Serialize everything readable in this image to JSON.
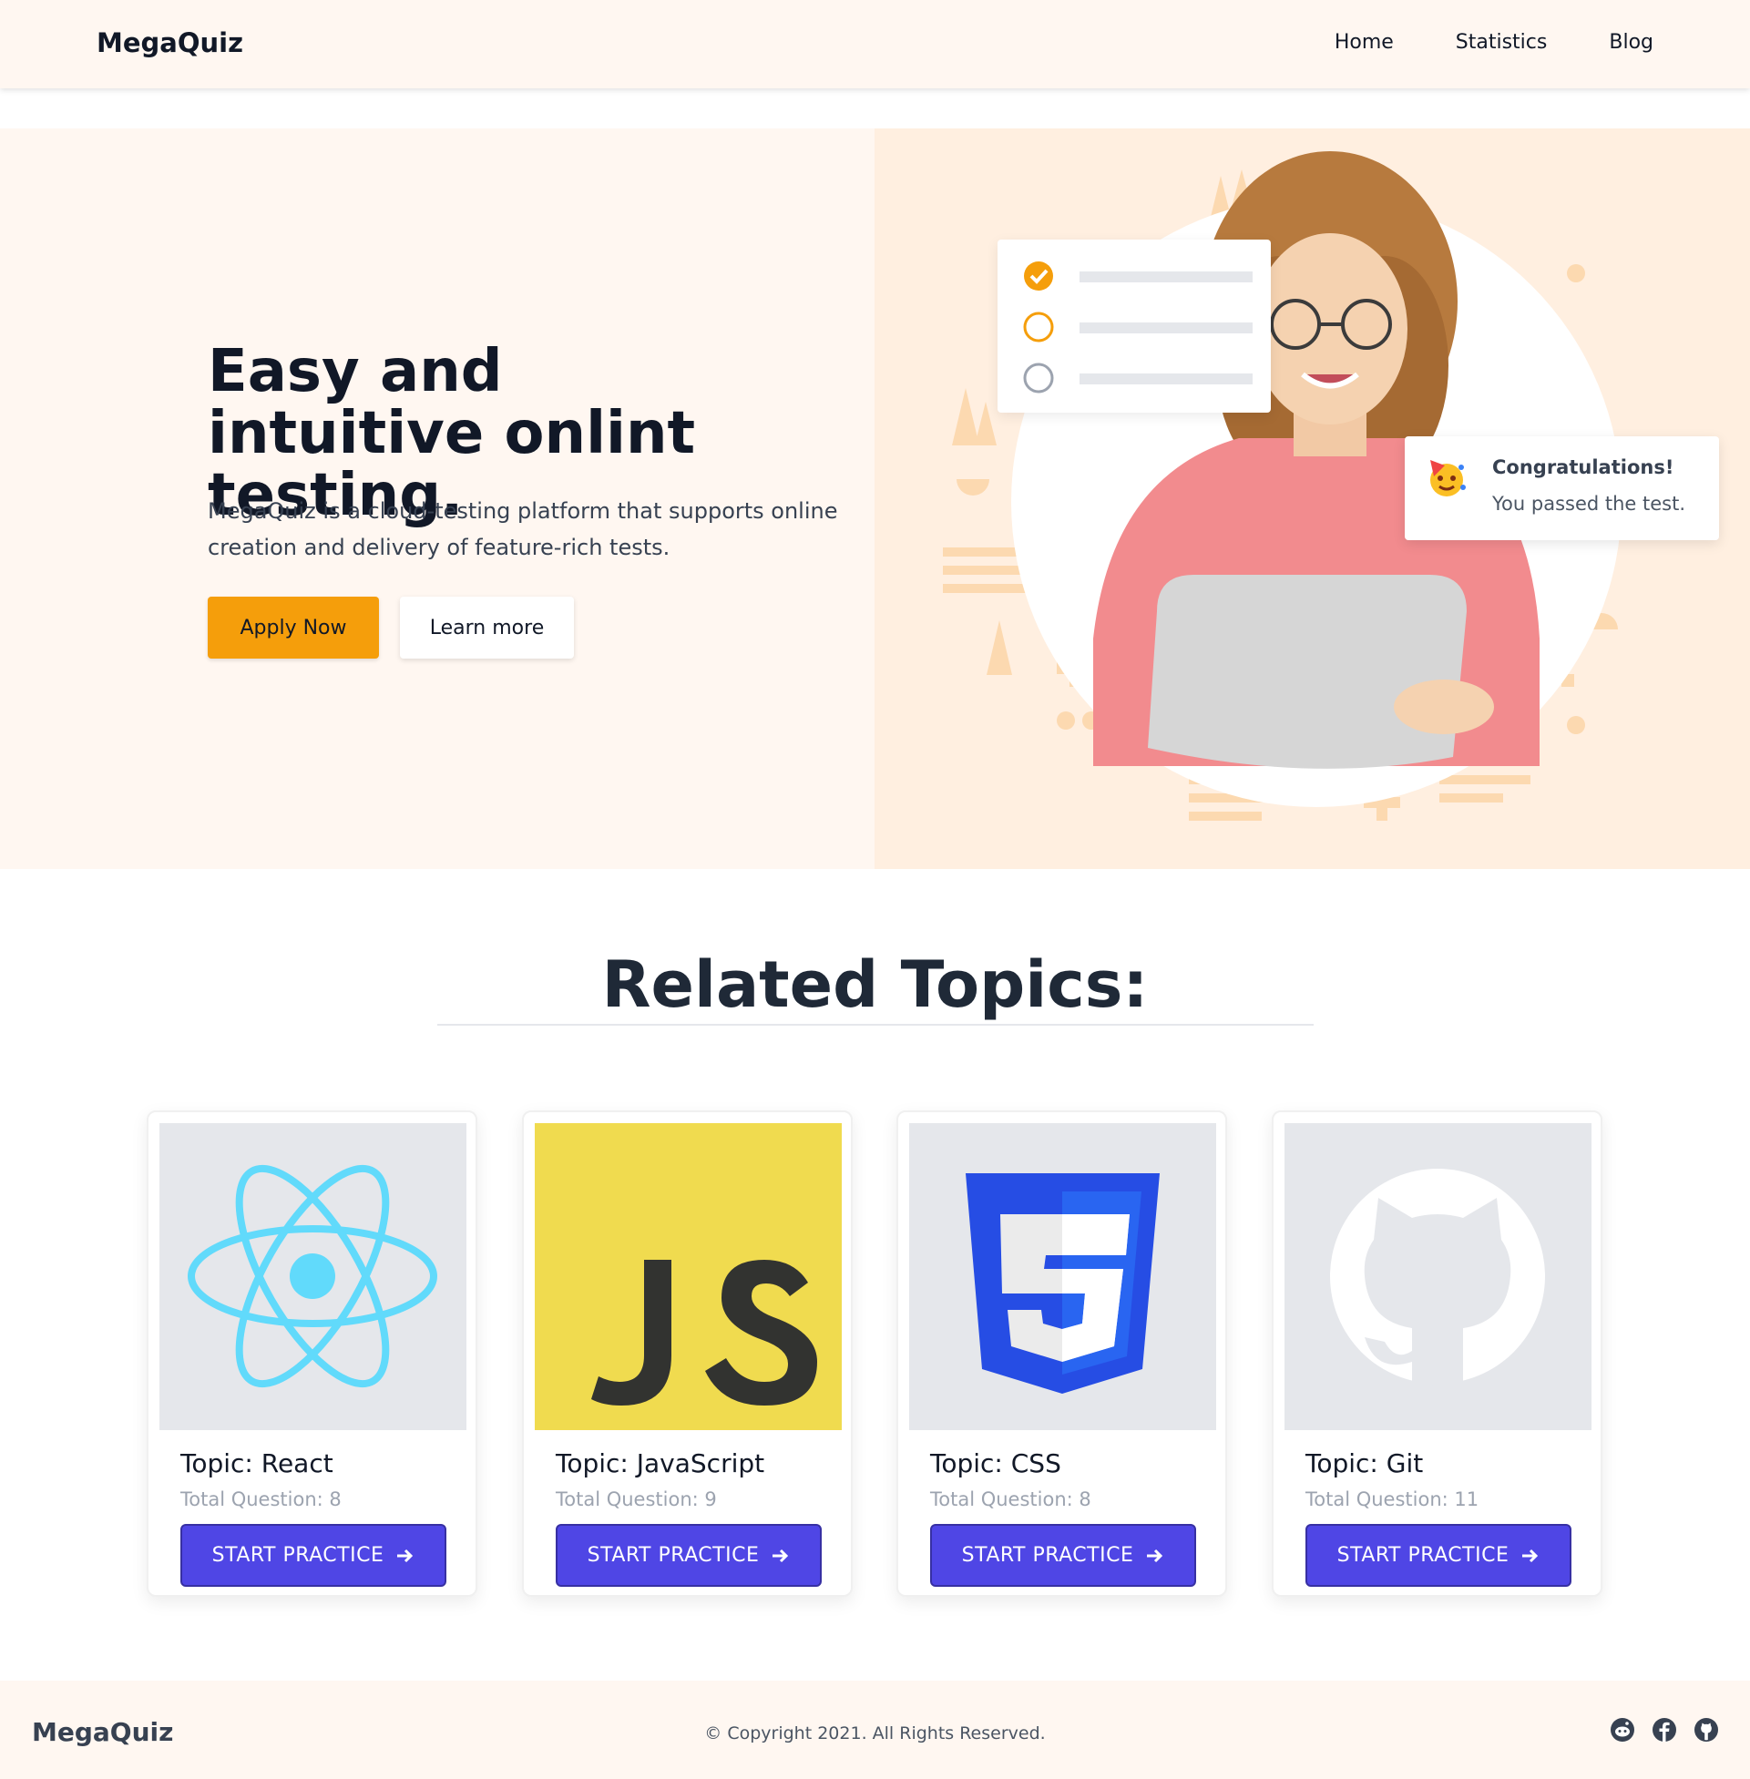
{
  "navbar": {
    "brand": "MegaQuiz",
    "links": [
      "Home",
      "Statistics",
      "Blog"
    ]
  },
  "hero": {
    "title": "Easy and intuitive onlint testing.",
    "description": "MegaQuiz is a cloud-testing platform that supports online creation and delivery of feature-rich tests.",
    "apply_label": "Apply Now",
    "learn_label": "Learn more",
    "congrats_title": "Congratulations!",
    "congrats_sub": "You passed the test."
  },
  "topics": {
    "heading": "Related Topics:",
    "button_label": "START PRACTICE",
    "cards": [
      {
        "title": "Topic: React",
        "count": "Total Question: 8",
        "icon": "react-logo-icon"
      },
      {
        "title": "Topic: JavaScript",
        "count": "Total Question: 9",
        "icon": "javascript-logo-icon"
      },
      {
        "title": "Topic: CSS",
        "count": "Total Question: 8",
        "icon": "css3-logo-icon"
      },
      {
        "title": "Topic: Git",
        "count": "Total Question: 11",
        "icon": "github-logo-icon"
      }
    ]
  },
  "footer": {
    "brand": "MegaQuiz",
    "copyright": "© Copyright 2021. All Rights Reserved.",
    "icons": [
      "reddit-icon",
      "facebook-icon",
      "github-icon"
    ]
  },
  "colors": {
    "accent": "#f59e0b",
    "primary": "#4f46e5",
    "hero_bg": "#fff7f1"
  }
}
